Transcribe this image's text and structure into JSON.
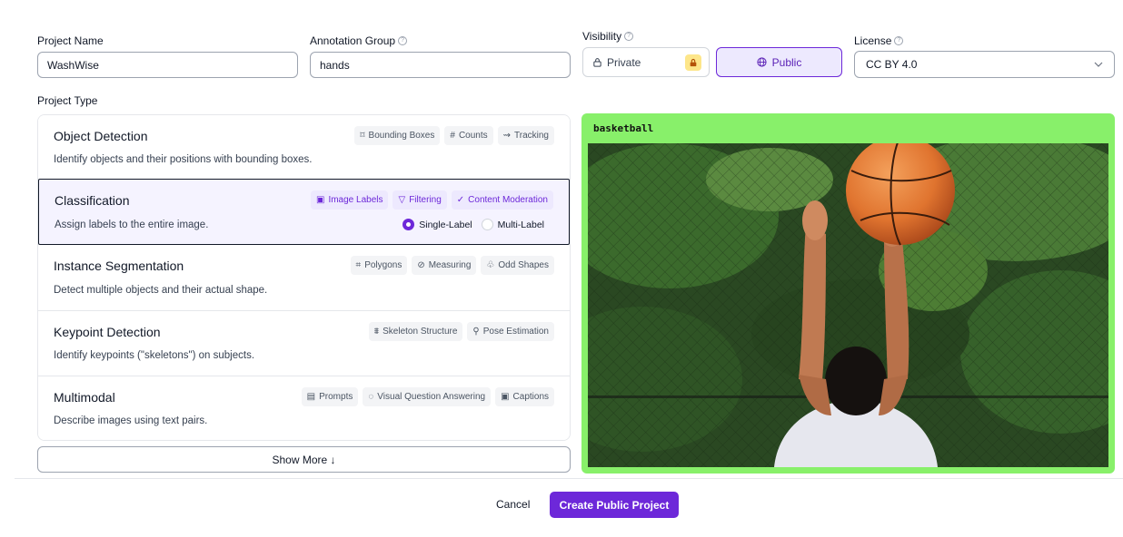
{
  "form": {
    "project_name": {
      "label": "Project Name",
      "value": "WashWise"
    },
    "annotation_group": {
      "label": "Annotation Group",
      "value": "hands"
    },
    "visibility": {
      "label": "Visibility",
      "private_label": "Private",
      "public_label": "Public",
      "selected": "Public"
    },
    "license": {
      "label": "License",
      "value": "CC BY 4.0"
    },
    "project_type_label": "Project Type"
  },
  "project_types": [
    {
      "title": "Object Detection",
      "description": "Identify objects and their positions with bounding boxes.",
      "tags": [
        "Bounding Boxes",
        "Counts",
        "Tracking"
      ]
    },
    {
      "title": "Classification",
      "description": "Assign labels to the entire image.",
      "tags": [
        "Image Labels",
        "Filtering",
        "Content Moderation"
      ],
      "options": {
        "single": "Single-Label",
        "multi": "Multi-Label",
        "selected": "Single-Label"
      }
    },
    {
      "title": "Instance Segmentation",
      "description": "Detect multiple objects and their actual shape.",
      "tags": [
        "Polygons",
        "Measuring",
        "Odd Shapes"
      ]
    },
    {
      "title": "Keypoint Detection",
      "description": "Identify keypoints (\"skeletons\") on subjects.",
      "tags": [
        "Skeleton Structure",
        "Pose Estimation"
      ]
    },
    {
      "title": "Multimodal",
      "description": "Describe images using text pairs.",
      "tags": [
        "Prompts",
        "Visual Question Answering",
        "Captions"
      ]
    }
  ],
  "show_more": "Show More ↓",
  "preview": {
    "label": "basketball"
  },
  "actions": {
    "cancel": "Cancel",
    "create": "Create Public Project"
  },
  "colors": {
    "accent": "#6d28d9",
    "preview_border": "#88f06a",
    "lock_badge": "#fde68a"
  }
}
